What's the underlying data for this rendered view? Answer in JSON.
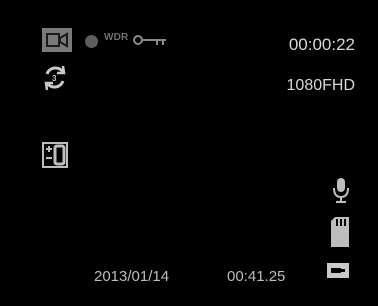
{
  "status": {
    "mode_icon": "video-camera-icon",
    "rec_icon": "record-dot-icon",
    "wdr_label": "WDR",
    "lock_icon": "key-icon",
    "loop_icon": "loop-recording-icon",
    "ev_icon": "exposure-icon"
  },
  "readouts": {
    "timer": "00:00:22",
    "resolution": "1080FHD"
  },
  "bottom": {
    "date": "2013/01/14",
    "time": "00:41.25"
  },
  "side_icons": [
    "microphone-icon",
    "sd-card-icon",
    "battery-icon"
  ],
  "colors": {
    "background": "#000000",
    "text": "#d8d8d8",
    "dim": "#5e5e5e"
  }
}
